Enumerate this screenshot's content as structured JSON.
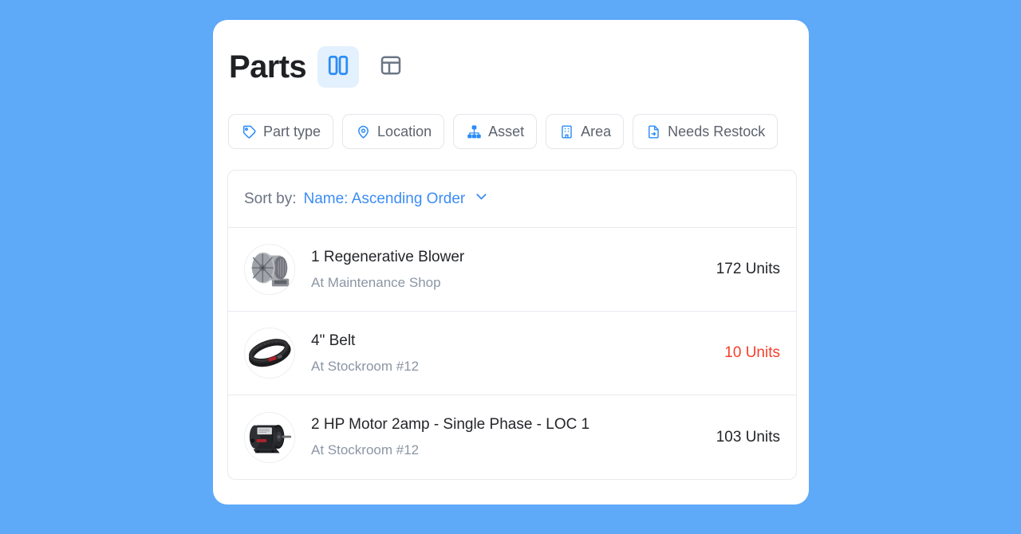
{
  "theme": {
    "background": "#5ea9f8",
    "card_background": "#ffffff",
    "accent": "#3b8cf5",
    "accent_soft": "#e3f0fd",
    "border": "#e8eaee",
    "text_primary": "#24262a",
    "text_muted": "#8b96a5",
    "alert": "#f5402c"
  },
  "header": {
    "title": "Parts",
    "views": [
      {
        "name": "split-view",
        "icon": "columns-icon",
        "active": true
      },
      {
        "name": "table-view",
        "icon": "layout-panel-icon",
        "active": false
      }
    ]
  },
  "filters": [
    {
      "label": "Part type",
      "icon": "tag-icon"
    },
    {
      "label": "Location",
      "icon": "map-pin-icon"
    },
    {
      "label": "Asset",
      "icon": "sitemap-icon"
    },
    {
      "label": "Area",
      "icon": "building-icon"
    },
    {
      "label": "Needs Restock",
      "icon": "file-import-icon"
    }
  ],
  "sort": {
    "label": "Sort by:",
    "value": "Name: Ascending Order",
    "icon": "chevron-down-icon"
  },
  "parts": [
    {
      "name": "1 Regenerative Blower",
      "location": "At Maintenance Shop",
      "quantity": "172 Units",
      "low_stock": false,
      "thumbnail": "regenerative-blower-photo"
    },
    {
      "name": "4\" Belt",
      "location": "At Stockroom #12",
      "quantity": "10 Units",
      "low_stock": true,
      "thumbnail": "v-belt-photo"
    },
    {
      "name": "2 HP Motor 2amp - Single Phase - LOC 1",
      "location": "At Stockroom #12",
      "quantity": "103 Units",
      "low_stock": false,
      "thumbnail": "electric-motor-photo"
    }
  ]
}
